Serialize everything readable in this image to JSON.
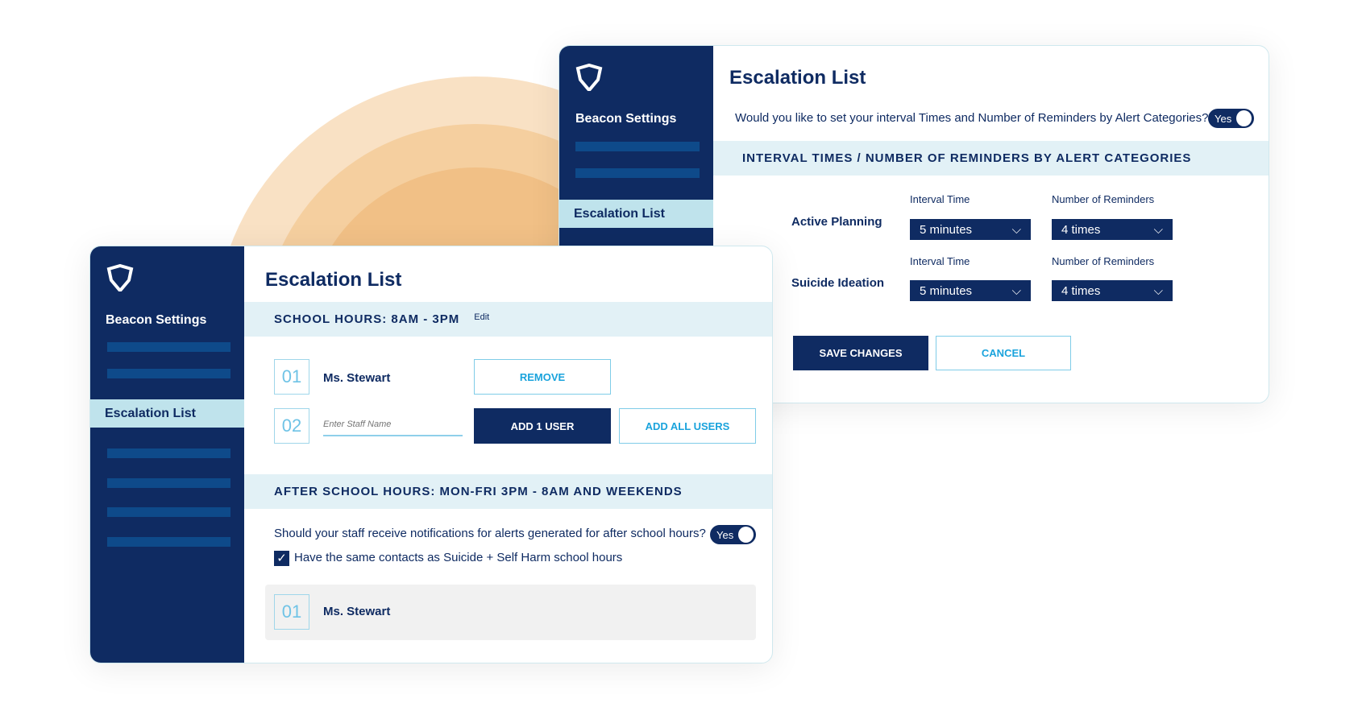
{
  "colors": {
    "navy": "#0f2b62",
    "accent": "#1aa3dc",
    "band": "#e2f1f6",
    "ring_outer": "#f9e1c4",
    "ring_mid": "#f5cf9f",
    "ring_inner": "#f1c086"
  },
  "back": {
    "sidebar": {
      "title": "Beacon Settings",
      "active": "Escalation List",
      "logo": "shield-logo"
    },
    "title": "Escalation List",
    "question": "Would you like to set your interval Times and Number of Reminders by Alert Categories?",
    "toggle": "Yes",
    "section": "INTERVAL TIMES / NUMBER OF REMINDERS BY ALERT CATEGORIES",
    "rows": [
      {
        "category": "Active Planning",
        "interval_label": "Interval Time",
        "interval": "5 minutes",
        "reminders_label": "Number of Reminders",
        "reminders": "4 times"
      },
      {
        "category": "Suicide Ideation",
        "interval_label": "Interval Time",
        "interval": "5 minutes",
        "reminders_label": "Number of Reminders",
        "reminders": "4 times"
      }
    ],
    "save": "SAVE CHANGES",
    "cancel": "CANCEL"
  },
  "front": {
    "sidebar": {
      "title": "Beacon Settings",
      "active": "Escalation List",
      "logo": "shield-logo"
    },
    "title": "Escalation List",
    "school_section": "SCHOOL HOURS: 8AM - 3PM",
    "edit": "Edit",
    "row1": {
      "num": "01",
      "name": "Ms. Stewart",
      "remove": "REMOVE"
    },
    "row2": {
      "num": "02",
      "placeholder": "Enter Staff Name",
      "add_one": "ADD 1 USER",
      "add_all": "ADD ALL USERS"
    },
    "after_section": "AFTER SCHOOL HOURS: MON-FRI 3PM - 8AM AND WEEKENDS",
    "question": "Should your staff receive notifications for alerts generated for after school hours?",
    "toggle": "Yes",
    "checkbox": {
      "label": "Have the same contacts as Suicide + Self Harm school hours",
      "checked": true
    },
    "contact": {
      "num": "01",
      "name": "Ms. Stewart"
    }
  }
}
